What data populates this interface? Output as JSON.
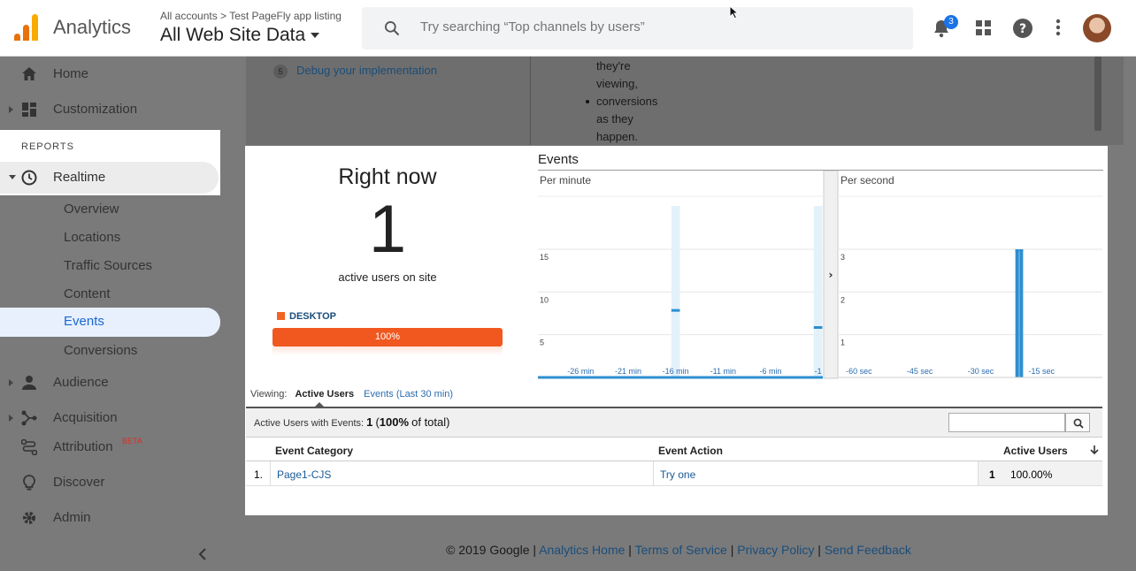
{
  "header": {
    "app_name": "Analytics",
    "breadcrumb_root": "All accounts",
    "breadcrumb_sep": ">",
    "breadcrumb_property": "Test PageFly app listing",
    "view_name": "All Web Site Data",
    "search_placeholder": "Try searching “Top channels by users”",
    "notification_count": "3",
    "icons": [
      "search-icon",
      "bell-icon",
      "apps-grid-icon",
      "help-icon",
      "more-vert-icon"
    ]
  },
  "sidebar": {
    "home": "Home",
    "customization": "Customization",
    "reports_heading": "REPORTS",
    "realtime": "Realtime",
    "realtime_items": [
      "Overview",
      "Locations",
      "Traffic Sources",
      "Content",
      "Events",
      "Conversions"
    ],
    "audience": "Audience",
    "acquisition": "Acquisition",
    "attribution": "Attribution",
    "attribution_badge": "BETA",
    "discover": "Discover",
    "admin": "Admin"
  },
  "background": {
    "debug_num": "5",
    "debug_link": "Debug your implementation",
    "bullet_lines": [
      "they're",
      "viewing,",
      "conversions",
      "as they",
      "happen."
    ]
  },
  "right_now": {
    "title": "Right now",
    "count": "1",
    "subtitle": "active users on site",
    "device_label": "DESKTOP",
    "device_percent": "100%",
    "device_fraction": 1.0,
    "device_color": "#f1581f"
  },
  "events": {
    "title": "Events",
    "expand_glyph": "›"
  },
  "chart_data": [
    {
      "type": "bar",
      "title": "Per minute",
      "x": [
        -30,
        -29,
        -28,
        -27,
        -26,
        -25,
        -24,
        -23,
        -22,
        -21,
        -20,
        -19,
        -18,
        -17,
        -16,
        -15,
        -14,
        -13,
        -12,
        -11,
        -10,
        -9,
        -8,
        -7,
        -6,
        -5,
        -4,
        -3,
        -2,
        -1
      ],
      "values": [
        0,
        0,
        0,
        0,
        0,
        0,
        0,
        0,
        0,
        0,
        0,
        0,
        0,
        0,
        8,
        0,
        0,
        0,
        0,
        0,
        0,
        0,
        0,
        0,
        0,
        0,
        0,
        0,
        0,
        6
      ],
      "tick_labels": [
        "-26 min",
        "-21 min",
        "-16 min",
        "-11 min",
        "-6 min",
        "-1"
      ],
      "tick_values": [
        -26,
        -21,
        -16,
        -11,
        -6,
        -1
      ],
      "y_ticks": [
        5,
        10,
        15
      ],
      "ylim": [
        0,
        18
      ],
      "xlim": [
        -30.5,
        -0.5
      ],
      "color": "#2d8fcf"
    },
    {
      "type": "bar",
      "title": "Per second",
      "x": [
        -21,
        -20
      ],
      "values": [
        3,
        3
      ],
      "tick_labels": [
        "-60 sec",
        "-45 sec",
        "-30 sec",
        "-15 sec"
      ],
      "tick_values": [
        -60,
        -45,
        -30,
        -15
      ],
      "y_ticks": [
        1,
        2,
        3
      ],
      "ylim": [
        0,
        3.6
      ],
      "xlim": [
        -65,
        0
      ],
      "color": "#2d8fcf"
    }
  ],
  "viewing": {
    "label": "Viewing:",
    "active": "Active Users",
    "other": "Events (Last 30 min)"
  },
  "table": {
    "summary_label": "Active Users with Events:",
    "summary_value": "1",
    "summary_pct": "100%",
    "summary_suffix": "of total)",
    "columns": [
      "Event Category",
      "Event Action",
      "Active Users"
    ],
    "rows": [
      {
        "index": "1.",
        "category": "Page1-CJS",
        "action": "Try one",
        "users": "1",
        "pct": "100.00%"
      }
    ]
  },
  "footer": {
    "copyright": "© 2019 Google",
    "links": [
      "Analytics Home",
      "Terms of Service",
      "Privacy Policy",
      "Send Feedback"
    ],
    "sep": "|"
  }
}
